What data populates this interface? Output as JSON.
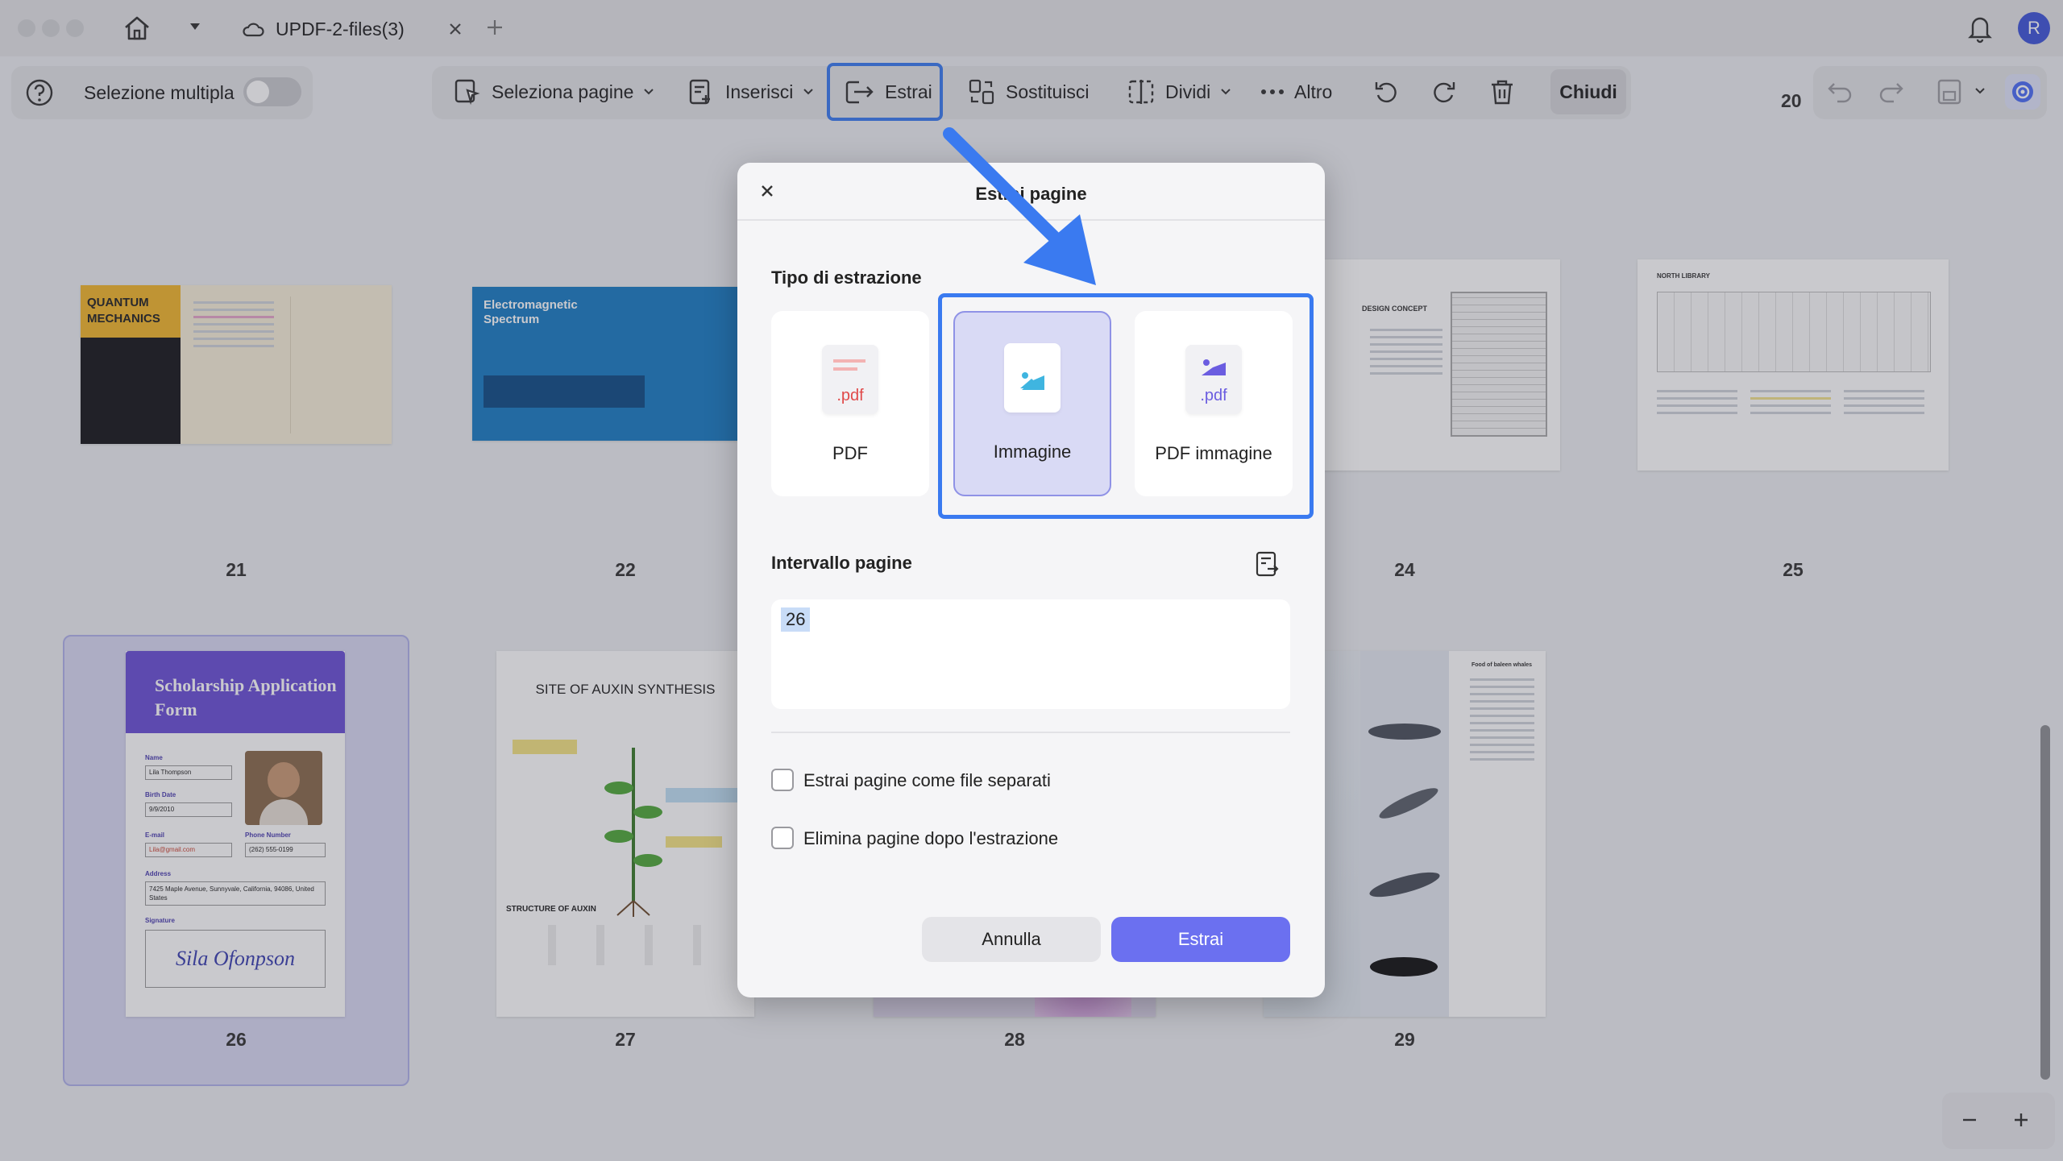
{
  "window": {
    "tab_title": "UPDF-2-files(3)",
    "avatar_initial": "R"
  },
  "toolbar": {
    "multiselect_label": "Selezione multipla",
    "select_pages": "Seleziona pagine",
    "insert": "Inserisci",
    "extract": "Estrai",
    "replace": "Sostituisci",
    "split": "Dividi",
    "more": "Altro",
    "close": "Chiudi",
    "page_indicator": "20"
  },
  "pages": [
    {
      "num": "21",
      "title": "QUANTUM MECHANICS"
    },
    {
      "num": "22",
      "title": "Electromagnetic Spectrum"
    },
    {
      "num": "24",
      "title": "DESIGN CONCEPT"
    },
    {
      "num": "25",
      "title": "NORTH LIBRARY"
    },
    {
      "num": "26",
      "title": "Scholarship Application Form",
      "name_label": "Name",
      "name_value": "Lila Thompson",
      "birth_label": "Birth Date",
      "birth_value": "9/9/2010",
      "email_label": "E-mail",
      "email_value": "Lila@gmail.com",
      "phone_label": "Phone Number",
      "phone_value": "(262) 555-0199",
      "address_label": "Address",
      "address_value": "7425 Maple Avenue, Sunnyvale, California, 94086, United States",
      "signature_label": "Signature",
      "signature_value": "Sila Ofonpson"
    },
    {
      "num": "27",
      "title": "SITE OF AUXIN SYNTHESIS",
      "subtitle": "STRUCTURE OF AUXIN"
    },
    {
      "num": "28"
    },
    {
      "num": "29",
      "title": "Food of baleen whales"
    }
  ],
  "dialog": {
    "title": "Estrai pagine",
    "extract_type_label": "Tipo di estrazione",
    "options": [
      {
        "label": "PDF",
        "ext": ".pdf",
        "icon": "pdf-file-icon"
      },
      {
        "label": "Immagine",
        "icon": "image-file-icon",
        "selected": true
      },
      {
        "label": "PDF immagine",
        "ext": ".pdf",
        "icon": "image-pdf-file-icon"
      }
    ],
    "range_label": "Intervallo pagine",
    "range_value": "26",
    "checkbox_separate": "Estrai pagine come file separati",
    "checkbox_delete": "Elimina pagine dopo l'estrazione",
    "cancel": "Annulla",
    "confirm": "Estrai"
  },
  "colors": {
    "accent": "#6b70f0",
    "highlight_blue": "#3a7af0",
    "selected_page": "#d8d8f3"
  }
}
